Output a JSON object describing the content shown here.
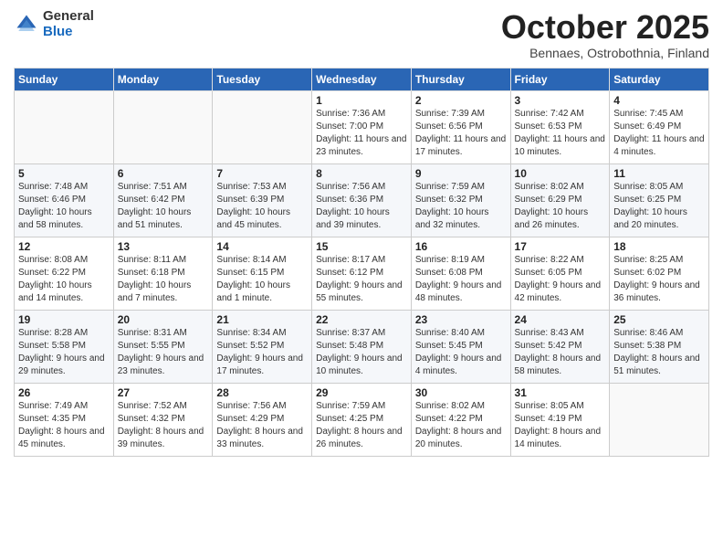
{
  "logo": {
    "general": "General",
    "blue": "Blue"
  },
  "title": "October 2025",
  "subtitle": "Bennaes, Ostrobothnia, Finland",
  "days_header": [
    "Sunday",
    "Monday",
    "Tuesday",
    "Wednesday",
    "Thursday",
    "Friday",
    "Saturday"
  ],
  "weeks": [
    [
      {
        "num": "",
        "sunrise": "",
        "sunset": "",
        "daylight": ""
      },
      {
        "num": "",
        "sunrise": "",
        "sunset": "",
        "daylight": ""
      },
      {
        "num": "",
        "sunrise": "",
        "sunset": "",
        "daylight": ""
      },
      {
        "num": "1",
        "sunrise": "Sunrise: 7:36 AM",
        "sunset": "Sunset: 7:00 PM",
        "daylight": "Daylight: 11 hours and 23 minutes."
      },
      {
        "num": "2",
        "sunrise": "Sunrise: 7:39 AM",
        "sunset": "Sunset: 6:56 PM",
        "daylight": "Daylight: 11 hours and 17 minutes."
      },
      {
        "num": "3",
        "sunrise": "Sunrise: 7:42 AM",
        "sunset": "Sunset: 6:53 PM",
        "daylight": "Daylight: 11 hours and 10 minutes."
      },
      {
        "num": "4",
        "sunrise": "Sunrise: 7:45 AM",
        "sunset": "Sunset: 6:49 PM",
        "daylight": "Daylight: 11 hours and 4 minutes."
      }
    ],
    [
      {
        "num": "5",
        "sunrise": "Sunrise: 7:48 AM",
        "sunset": "Sunset: 6:46 PM",
        "daylight": "Daylight: 10 hours and 58 minutes."
      },
      {
        "num": "6",
        "sunrise": "Sunrise: 7:51 AM",
        "sunset": "Sunset: 6:42 PM",
        "daylight": "Daylight: 10 hours and 51 minutes."
      },
      {
        "num": "7",
        "sunrise": "Sunrise: 7:53 AM",
        "sunset": "Sunset: 6:39 PM",
        "daylight": "Daylight: 10 hours and 45 minutes."
      },
      {
        "num": "8",
        "sunrise": "Sunrise: 7:56 AM",
        "sunset": "Sunset: 6:36 PM",
        "daylight": "Daylight: 10 hours and 39 minutes."
      },
      {
        "num": "9",
        "sunrise": "Sunrise: 7:59 AM",
        "sunset": "Sunset: 6:32 PM",
        "daylight": "Daylight: 10 hours and 32 minutes."
      },
      {
        "num": "10",
        "sunrise": "Sunrise: 8:02 AM",
        "sunset": "Sunset: 6:29 PM",
        "daylight": "Daylight: 10 hours and 26 minutes."
      },
      {
        "num": "11",
        "sunrise": "Sunrise: 8:05 AM",
        "sunset": "Sunset: 6:25 PM",
        "daylight": "Daylight: 10 hours and 20 minutes."
      }
    ],
    [
      {
        "num": "12",
        "sunrise": "Sunrise: 8:08 AM",
        "sunset": "Sunset: 6:22 PM",
        "daylight": "Daylight: 10 hours and 14 minutes."
      },
      {
        "num": "13",
        "sunrise": "Sunrise: 8:11 AM",
        "sunset": "Sunset: 6:18 PM",
        "daylight": "Daylight: 10 hours and 7 minutes."
      },
      {
        "num": "14",
        "sunrise": "Sunrise: 8:14 AM",
        "sunset": "Sunset: 6:15 PM",
        "daylight": "Daylight: 10 hours and 1 minute."
      },
      {
        "num": "15",
        "sunrise": "Sunrise: 8:17 AM",
        "sunset": "Sunset: 6:12 PM",
        "daylight": "Daylight: 9 hours and 55 minutes."
      },
      {
        "num": "16",
        "sunrise": "Sunrise: 8:19 AM",
        "sunset": "Sunset: 6:08 PM",
        "daylight": "Daylight: 9 hours and 48 minutes."
      },
      {
        "num": "17",
        "sunrise": "Sunrise: 8:22 AM",
        "sunset": "Sunset: 6:05 PM",
        "daylight": "Daylight: 9 hours and 42 minutes."
      },
      {
        "num": "18",
        "sunrise": "Sunrise: 8:25 AM",
        "sunset": "Sunset: 6:02 PM",
        "daylight": "Daylight: 9 hours and 36 minutes."
      }
    ],
    [
      {
        "num": "19",
        "sunrise": "Sunrise: 8:28 AM",
        "sunset": "Sunset: 5:58 PM",
        "daylight": "Daylight: 9 hours and 29 minutes."
      },
      {
        "num": "20",
        "sunrise": "Sunrise: 8:31 AM",
        "sunset": "Sunset: 5:55 PM",
        "daylight": "Daylight: 9 hours and 23 minutes."
      },
      {
        "num": "21",
        "sunrise": "Sunrise: 8:34 AM",
        "sunset": "Sunset: 5:52 PM",
        "daylight": "Daylight: 9 hours and 17 minutes."
      },
      {
        "num": "22",
        "sunrise": "Sunrise: 8:37 AM",
        "sunset": "Sunset: 5:48 PM",
        "daylight": "Daylight: 9 hours and 10 minutes."
      },
      {
        "num": "23",
        "sunrise": "Sunrise: 8:40 AM",
        "sunset": "Sunset: 5:45 PM",
        "daylight": "Daylight: 9 hours and 4 minutes."
      },
      {
        "num": "24",
        "sunrise": "Sunrise: 8:43 AM",
        "sunset": "Sunset: 5:42 PM",
        "daylight": "Daylight: 8 hours and 58 minutes."
      },
      {
        "num": "25",
        "sunrise": "Sunrise: 8:46 AM",
        "sunset": "Sunset: 5:38 PM",
        "daylight": "Daylight: 8 hours and 51 minutes."
      }
    ],
    [
      {
        "num": "26",
        "sunrise": "Sunrise: 7:49 AM",
        "sunset": "Sunset: 4:35 PM",
        "daylight": "Daylight: 8 hours and 45 minutes."
      },
      {
        "num": "27",
        "sunrise": "Sunrise: 7:52 AM",
        "sunset": "Sunset: 4:32 PM",
        "daylight": "Daylight: 8 hours and 39 minutes."
      },
      {
        "num": "28",
        "sunrise": "Sunrise: 7:56 AM",
        "sunset": "Sunset: 4:29 PM",
        "daylight": "Daylight: 8 hours and 33 minutes."
      },
      {
        "num": "29",
        "sunrise": "Sunrise: 7:59 AM",
        "sunset": "Sunset: 4:25 PM",
        "daylight": "Daylight: 8 hours and 26 minutes."
      },
      {
        "num": "30",
        "sunrise": "Sunrise: 8:02 AM",
        "sunset": "Sunset: 4:22 PM",
        "daylight": "Daylight: 8 hours and 20 minutes."
      },
      {
        "num": "31",
        "sunrise": "Sunrise: 8:05 AM",
        "sunset": "Sunset: 4:19 PM",
        "daylight": "Daylight: 8 hours and 14 minutes."
      },
      {
        "num": "",
        "sunrise": "",
        "sunset": "",
        "daylight": ""
      }
    ]
  ]
}
